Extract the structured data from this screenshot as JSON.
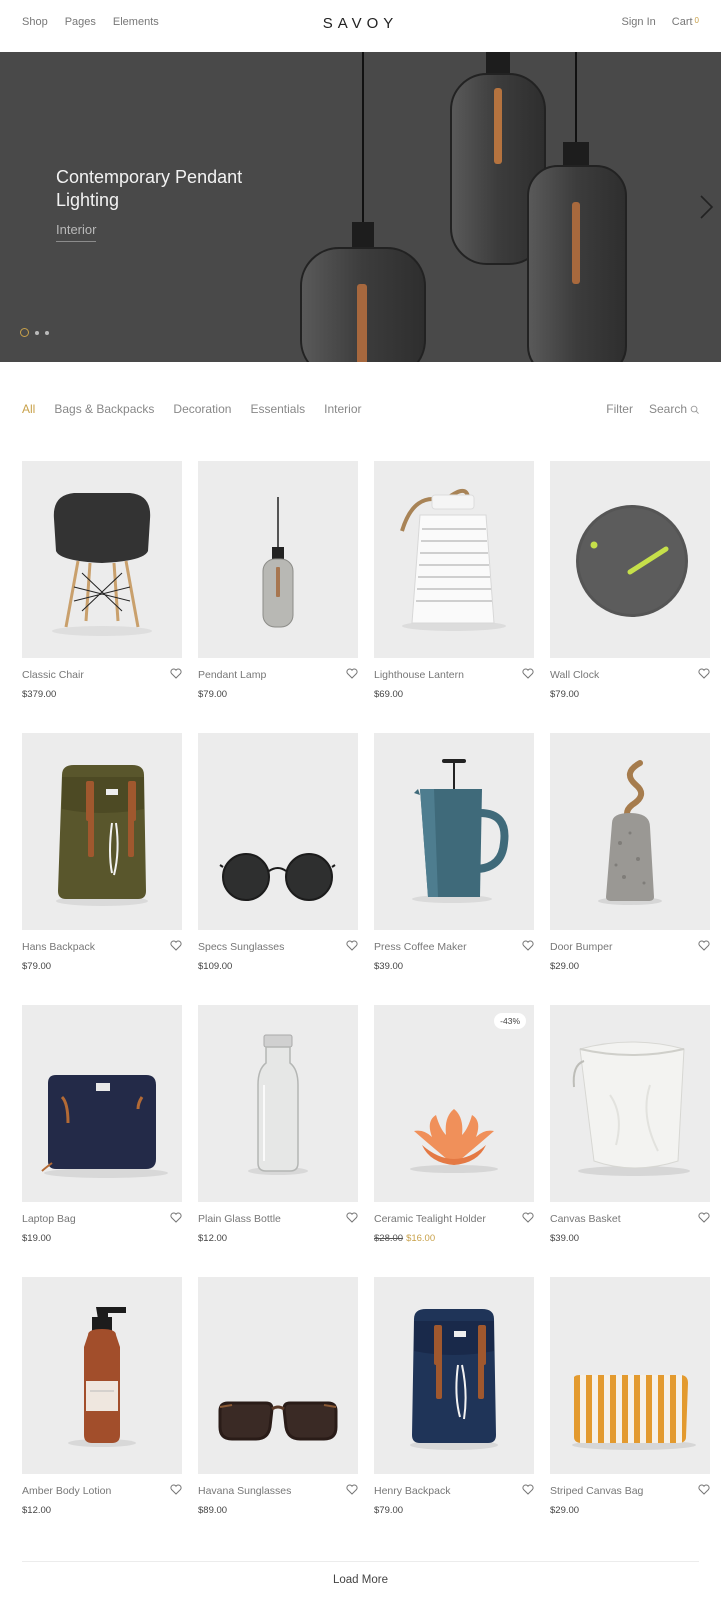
{
  "header": {
    "nav_left": [
      "Shop",
      "Pages",
      "Elements"
    ],
    "logo": "SAVOY",
    "sign_in": "Sign In",
    "cart": "Cart",
    "cart_count": "0"
  },
  "hero": {
    "title": "Contemporary Pendant Lighting",
    "tag": "Interior",
    "slides": 3,
    "active_slide": 1
  },
  "filters": {
    "categories": [
      "All",
      "Bags & Backpacks",
      "Decoration",
      "Essentials",
      "Interior"
    ],
    "active": "All",
    "filter_label": "Filter",
    "search_label": "Search"
  },
  "products": [
    {
      "name": "Classic Chair",
      "price": "$379.00",
      "icon": "chair"
    },
    {
      "name": "Pendant Lamp",
      "price": "$79.00",
      "icon": "pendant-lamp"
    },
    {
      "name": "Lighthouse Lantern",
      "price": "$69.00",
      "icon": "lantern"
    },
    {
      "name": "Wall Clock",
      "price": "$79.00",
      "icon": "clock"
    },
    {
      "name": "Hans Backpack",
      "price": "$79.00",
      "icon": "backpack-green"
    },
    {
      "name": "Specs Sunglasses",
      "price": "$109.00",
      "icon": "round-sunglasses"
    },
    {
      "name": "Press Coffee Maker",
      "price": "$39.00",
      "icon": "coffee-press"
    },
    {
      "name": "Door Bumper",
      "price": "$29.00",
      "icon": "door-bumper"
    },
    {
      "name": "Laptop Bag",
      "price": "$19.00",
      "icon": "laptop-bag"
    },
    {
      "name": "Plain Glass Bottle",
      "price": "$12.00",
      "icon": "glass-bottle"
    },
    {
      "name": "Ceramic Tealight Holder",
      "old_price": "$28.00",
      "price": "$16.00",
      "badge": "-43%",
      "icon": "tealight-holder"
    },
    {
      "name": "Canvas Basket",
      "price": "$39.00",
      "icon": "canvas-basket"
    },
    {
      "name": "Amber Body Lotion",
      "price": "$12.00",
      "icon": "lotion-bottle"
    },
    {
      "name": "Havana Sunglasses",
      "price": "$89.00",
      "icon": "havana-sunglasses"
    },
    {
      "name": "Henry Backpack",
      "price": "$79.00",
      "icon": "backpack-navy"
    },
    {
      "name": "Striped Canvas Bag",
      "price": "$29.00",
      "icon": "striped-bag"
    }
  ],
  "load_more": "Load More",
  "colors": {
    "accent": "#c8a14a",
    "hero_bg": "#494949",
    "card_bg": "#ececec"
  }
}
